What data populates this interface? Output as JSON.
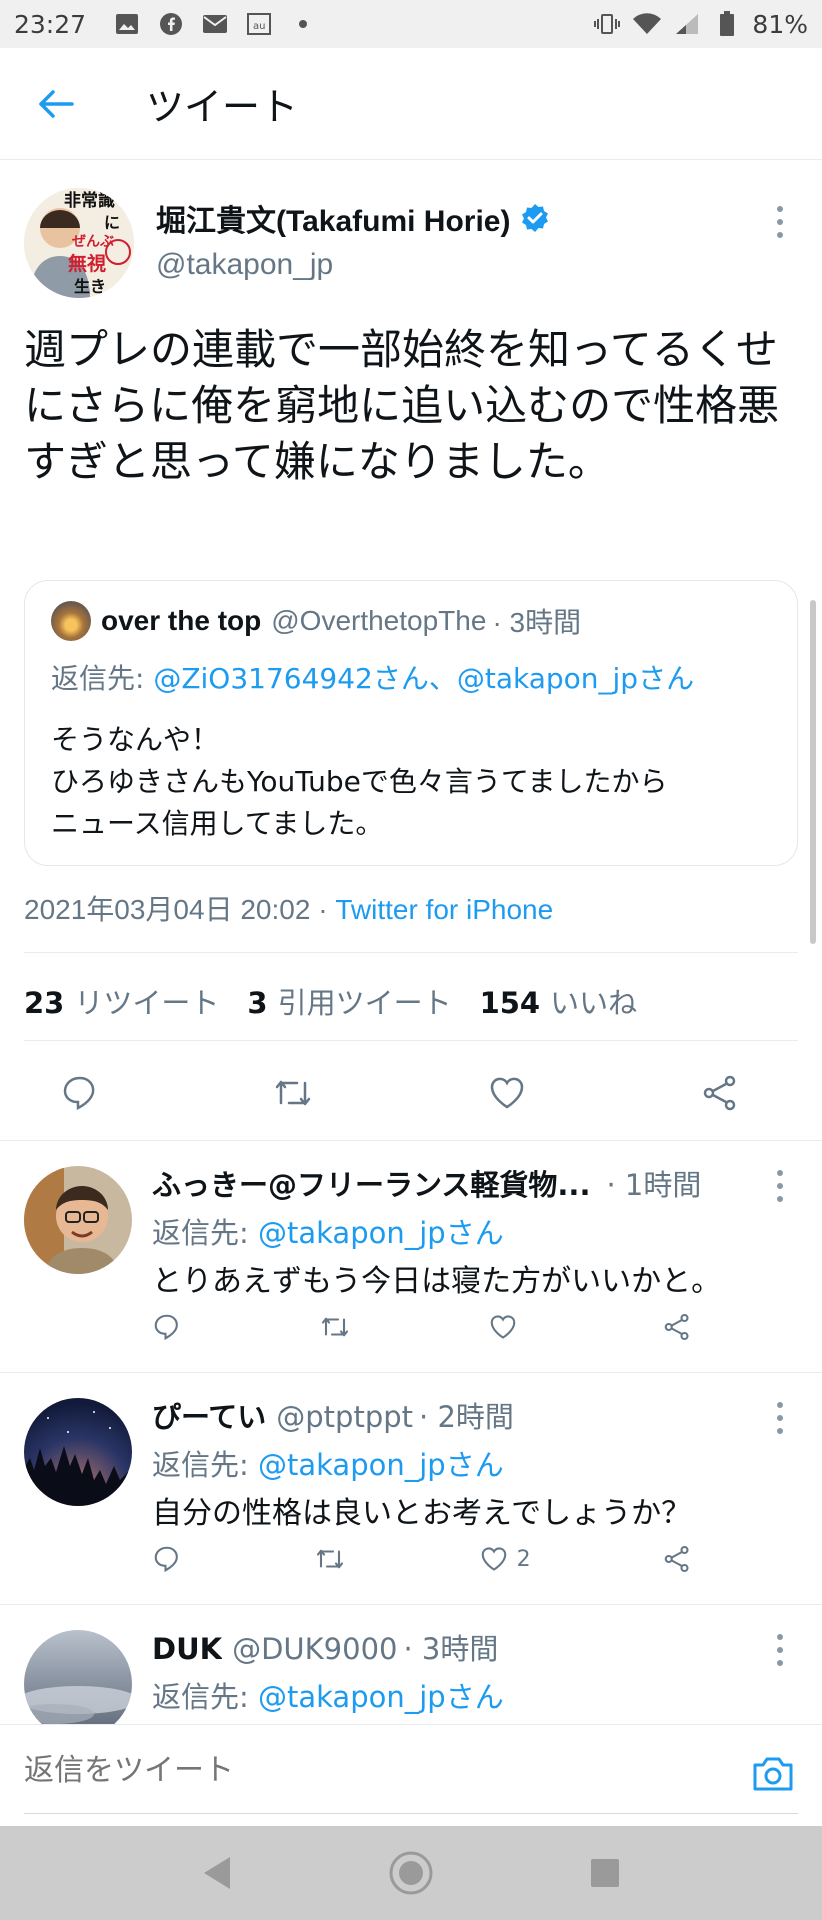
{
  "status_bar": {
    "time": "23:27",
    "battery": "81%",
    "left_icons": [
      "image-icon",
      "facebook-icon",
      "mail-icon",
      "au-icon",
      "dot-icon"
    ],
    "right_icons": [
      "vibrate-icon",
      "wifi-icon",
      "signal-icon",
      "battery-icon"
    ]
  },
  "header": {
    "title": "ツイート"
  },
  "tweet": {
    "author_name": "堀江貴文(Takafumi Horie)",
    "author_handle": "@takapon_jp",
    "avatar_text": [
      "非常識",
      "に",
      "ぜんぶ",
      "無視",
      "生き"
    ],
    "text": "週プレの連載で一部始終を知ってるくせにさらに俺を窮地に追い込むので性格悪すぎと思って嫌になりました。",
    "quote": {
      "name": "over the top",
      "handle": "@OverthetopThe",
      "time": "· 3時間",
      "reply_to_prefix": "返信先: ",
      "reply_to_users": "@ZiO31764942さん、@takapon_jpさん",
      "body_line1": "そうなんや！",
      "body_line2": "ひろゆきさんもYouTubeで色々言うてましたから",
      "body_line3": "ニュース信用してました。"
    },
    "timestamp": "2021年03月04日 20:02",
    "timestamp_sep": " · ",
    "client": "Twitter for iPhone",
    "stats": {
      "retweets_count": "23",
      "retweets_label": "リツイート",
      "quotes_count": "3",
      "quotes_label": "引用ツイート",
      "likes_count": "154",
      "likes_label": "いいね"
    }
  },
  "replies": [
    {
      "name": "ふっきー@フリーランス軽貨物...",
      "handle": "",
      "time": "· 1時間",
      "reply_to_prefix": "返信先: ",
      "reply_to_user": "@takapon_jpさん",
      "text": "とりあえずもう今日は寝た方がいいかと。",
      "like_count": ""
    },
    {
      "name": "ぴーてい",
      "handle": "@ptptppt",
      "time": "· 2時間",
      "reply_to_prefix": "返信先: ",
      "reply_to_user": "@takapon_jpさん",
      "text": "自分の性格は良いとお考えでしょうか？",
      "like_count": "2"
    },
    {
      "name": "DUK",
      "handle": "@DUK9000",
      "time": "· 3時間",
      "reply_to_prefix": "返信先: ",
      "reply_to_user": "@takapon_jpさん",
      "text": "",
      "like_count": ""
    }
  ],
  "composer": {
    "placeholder": "返信をツイート"
  },
  "colors": {
    "accent": "#1d9bf0",
    "secondary_text": "#657786",
    "divider": "#e6ecf0"
  }
}
